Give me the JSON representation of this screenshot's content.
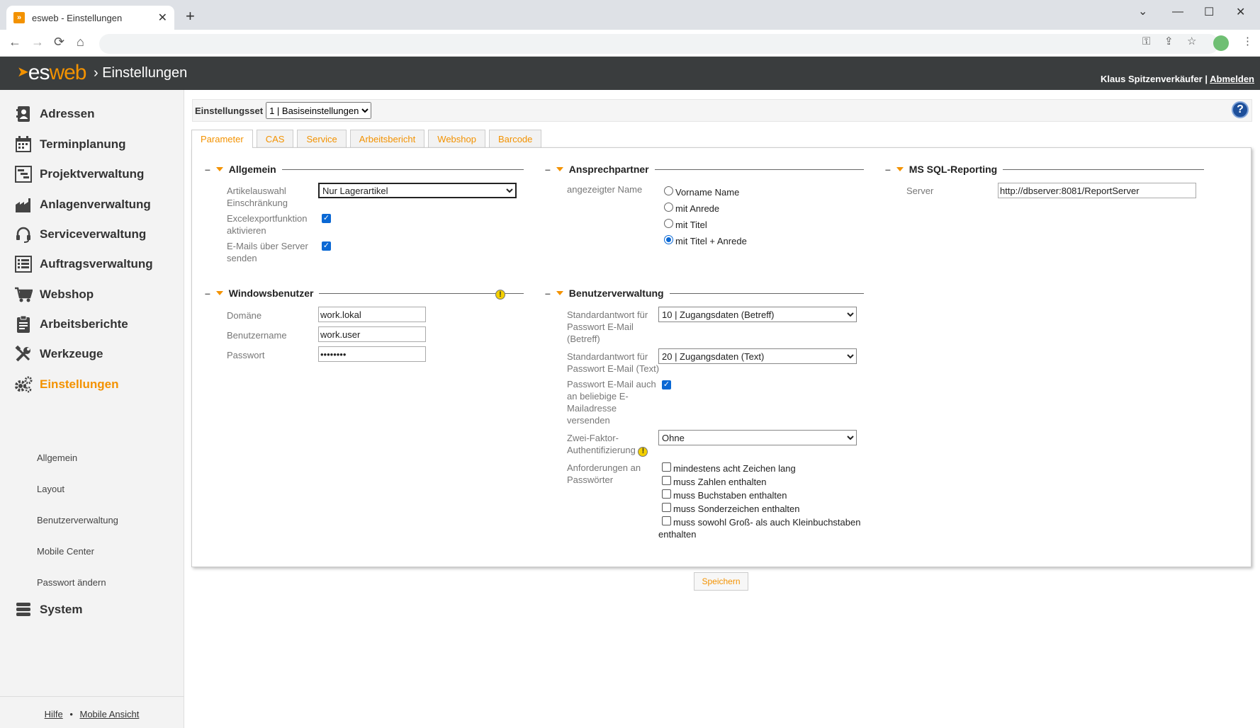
{
  "browser": {
    "tab_title": "esweb - Einstellungen",
    "tab_favicon": "esweb-favicon",
    "close_glyph": "✕",
    "newtab_glyph": "+",
    "back_glyph": "←",
    "forward_glyph": "→",
    "reload_glyph": "⟳",
    "home_glyph": "⌂",
    "minimize_glyph": "—",
    "maximize_glyph": "☐",
    "winclose_glyph": "✕",
    "chevron_glyph": "⌄",
    "key_glyph": "⚿",
    "share_glyph": "⇪",
    "star_glyph": "☆",
    "menu_glyph": "⋮"
  },
  "header": {
    "logo_es": "es",
    "logo_web": "web",
    "crumb": "› Einstellungen",
    "user": "Klaus Spitzenverkäufer",
    "separator": "|",
    "logout": "Abmelden"
  },
  "sidebar": {
    "items": [
      {
        "label": "Adressen",
        "icon": "address-book-icon"
      },
      {
        "label": "Terminplanung",
        "icon": "calendar-icon"
      },
      {
        "label": "Projektverwaltung",
        "icon": "gantt-icon"
      },
      {
        "label": "Anlagenverwaltung",
        "icon": "factory-icon"
      },
      {
        "label": "Serviceverwaltung",
        "icon": "headset-icon"
      },
      {
        "label": "Auftragsverwaltung",
        "icon": "list-icon"
      },
      {
        "label": "Webshop",
        "icon": "cart-icon"
      },
      {
        "label": "Arbeitsberichte",
        "icon": "clipboard-icon"
      },
      {
        "label": "Werkzeuge",
        "icon": "tools-icon"
      },
      {
        "label": "Einstellungen",
        "icon": "gears-icon"
      },
      {
        "label": "System",
        "icon": "database-icon"
      }
    ],
    "subitems": [
      "Allgemein",
      "Layout",
      "Benutzerverwaltung",
      "Mobile Center",
      "Passwort ändern"
    ],
    "footer": {
      "help": "Hilfe",
      "dot": "•",
      "mobile": "Mobile Ansicht"
    }
  },
  "settings_bar": {
    "label": "Einstellungsset",
    "value": "1 | Basiseinstellungen",
    "help_glyph": "?"
  },
  "tabs": [
    "Parameter",
    "CAS",
    "Service",
    "Arbeitsbericht",
    "Webshop",
    "Barcode"
  ],
  "allgemein": {
    "title": "Allgemein",
    "article_label_1": "Artikelauswahl",
    "article_label_2": "Einschränkung",
    "article_value": "Nur Lagerartikel",
    "excel_label_1": "Excelexportfunktion",
    "excel_label_2": "aktivieren",
    "excel_checked": true,
    "mail_label_1": "E-Mails über Server",
    "mail_label_2": "senden",
    "mail_checked": true
  },
  "ansprechpartner": {
    "title": "Ansprechpartner",
    "label": "angezeigter Name",
    "options": [
      "Vorname Name",
      "mit Anrede",
      "mit Titel",
      "mit Titel + Anrede"
    ],
    "selected": "mit Titel + Anrede"
  },
  "mssql": {
    "title": "MS SQL-Reporting",
    "server_label": "Server",
    "server_value": "http://dbserver:8081/ReportServer"
  },
  "windowsbenutzer": {
    "title": "Windowsbenutzer",
    "warn_glyph": "!",
    "domain_label": "Domäne",
    "domain_value": "work.lokal",
    "user_label": "Benutzername",
    "user_value": "work.user",
    "pass_label": "Passwort",
    "pass_value": "••••••••"
  },
  "benutzerverwaltung": {
    "title": "Benutzerverwaltung",
    "betreff_label": [
      "Standardantwort für",
      "Passwort E-Mail",
      "(Betreff)"
    ],
    "betreff_value": "10 | Zugangsdaten (Betreff)",
    "text_label": [
      "Standardantwort für",
      "Passwort E-Mail (Text)"
    ],
    "text_value": "20 | Zugangsdaten (Text)",
    "any_label": [
      "Passwort E-Mail auch",
      "an beliebige E-",
      "Mailadresse",
      "versenden"
    ],
    "any_checked": true,
    "twofactor_label": [
      "Zwei-Faktor-",
      "Authentifizierung"
    ],
    "twofactor_value": "Ohne",
    "warn_glyph": "!",
    "requirements_label": [
      "Anforderungen an",
      "Passwörter"
    ],
    "requirements": [
      "mindestens acht Zeichen lang",
      "muss Zahlen enthalten",
      "muss Buchstaben enthalten",
      "muss Sonderzeichen enthalten",
      "muss sowohl Groß- als auch Kleinbuchstaben",
      "enthalten"
    ]
  },
  "save_label": "Speichern",
  "colors": {
    "accent": "#f39200",
    "header_bg": "#3a3d3e",
    "checkbox": "#0a68d4"
  }
}
